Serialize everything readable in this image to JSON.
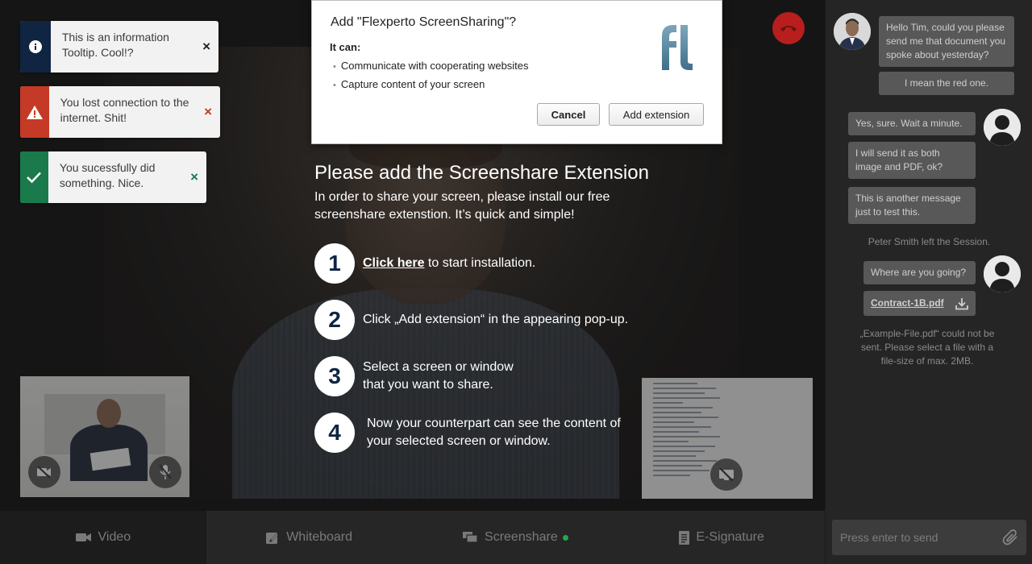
{
  "toasts": {
    "info": {
      "text": "This is an information Tooltip. Cool!?",
      "close": "×"
    },
    "error": {
      "text": "You lost connection to the internet. Shit!",
      "close": "×"
    },
    "success": {
      "text": "You sucessfully did something. Nice.",
      "close": "×"
    }
  },
  "instructions": {
    "title": "Please add the Screenshare Extension",
    "subtitle": "In order to share your screen, please install our free screenshare extenstion. It’s quick and simple!",
    "steps": [
      {
        "number": "1",
        "link": "Click here",
        "text": " to start installation."
      },
      {
        "number": "2",
        "text": "Click „Add extension“ in the appearing pop-up."
      },
      {
        "number": "3",
        "text": "Select a screen or window that you want to share."
      },
      {
        "number": "4",
        "text": "Now your counterpart can see the content of your selected screen or window."
      }
    ]
  },
  "extension_dialog": {
    "title": "Add \"Flexperto ScreenSharing\"?",
    "it_can": "It can:",
    "permissions": [
      "Communicate with cooperating websites",
      "Capture content of your screen"
    ],
    "cancel_label": "Cancel",
    "add_label": "Add extension"
  },
  "tabs": [
    {
      "label": "Video",
      "icon": "video-camera-icon"
    },
    {
      "label": "Whiteboard",
      "icon": "whiteboard-icon"
    },
    {
      "label": "Screenshare",
      "icon": "screenshare-icon",
      "active_indicator_color": "#27a844"
    },
    {
      "label": "E-Signature",
      "icon": "document-icon"
    }
  ],
  "chat": {
    "messages": [
      {
        "side": "left",
        "text": "Hello Tim, could you please send me that document you spoke about yesterday?"
      },
      {
        "side": "left",
        "text": "I mean the red one."
      },
      {
        "side": "right",
        "text": "Yes, sure. Wait a minute."
      },
      {
        "side": "right",
        "text": "I will send it as both image and PDF, ok?"
      },
      {
        "side": "right",
        "text": "This is another message just to test this."
      },
      {
        "side": "right",
        "text": "Where are you going?"
      }
    ],
    "system_left": "Peter Smith left the Session.",
    "attachment": "Contract-1B.pdf",
    "error": "„Example-File.pdf“ could not be sent. Please select a file with a file-size of max. 2MB.",
    "input_placeholder": "Press enter to send"
  },
  "colors": {
    "brand_navy": "#0f2542",
    "error_red": "#c53a26",
    "success_green": "#1a7a4c",
    "hangup_red": "#b81e1e"
  }
}
